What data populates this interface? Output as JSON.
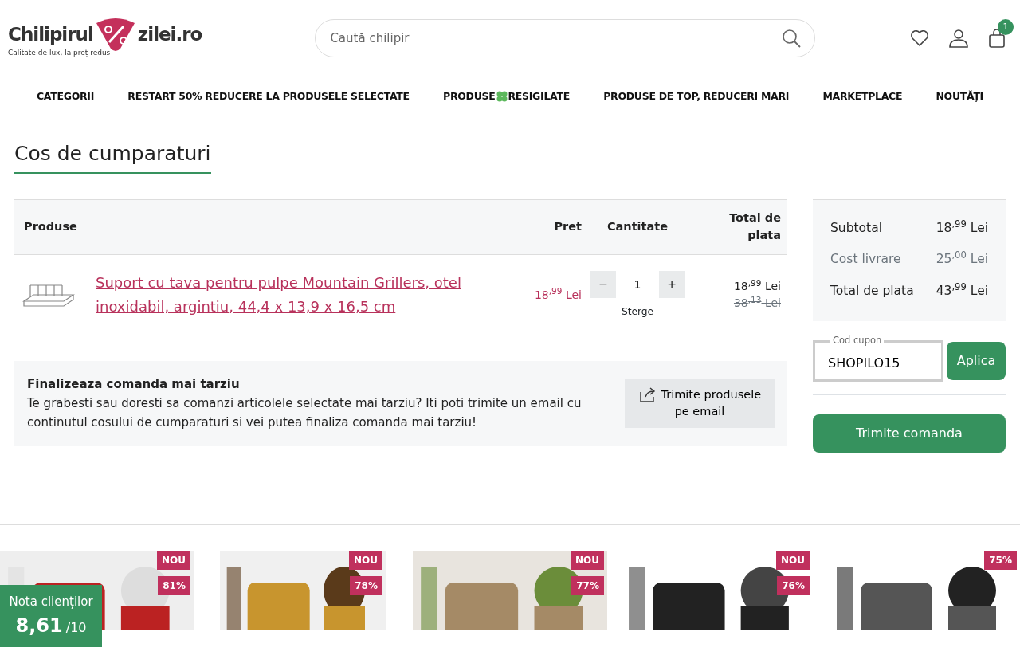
{
  "header": {
    "logo": {
      "left": "Chilipirul",
      "right": "zilei.ro",
      "tagline": "Calitate de lux, la preț redus"
    },
    "search": {
      "placeholder": "Caută chilipir"
    },
    "cart_count": "1"
  },
  "nav": [
    {
      "label": "CATEGORII"
    },
    {
      "label": "RESTART 50% REDUCERE LA PRODUSELE SELECTATE"
    },
    {
      "label": "PRODUSE",
      "label_after": "RESIGILATE",
      "clover": true
    },
    {
      "label": "PRODUSE DE TOP, REDUCERI MARI"
    },
    {
      "label": "MARKETPLACE"
    },
    {
      "label": "NOUTĂȚI"
    }
  ],
  "page_title": "Cos de cumparaturi",
  "table": {
    "columns": [
      "Produse",
      "Pret",
      "Cantitate",
      "Total de plata"
    ],
    "rows": [
      {
        "name": "Suport cu tava pentru pulpe Mountain Grillers, otel inoxidabil, argintiu, 44,4 x 13,9 x 16,5 cm",
        "price": "18$^{,99}$ Lei",
        "quantity": "1",
        "minus": "−",
        "plus": "+",
        "remove": "Sterge",
        "total": "18$^{,99}$ Lei",
        "old_total": "38$^{,13}$ Lei"
      }
    ]
  },
  "later": {
    "title": "Finalizeaza comanda mai tarziu",
    "text": "Te grabesti sau doresti sa comanzi articolele selectate mai tarziu? Iti poti trimite un email cu continutul cosului de cumparaturi si vei putea finaliza comanda mai tarziu!",
    "button": "Trimite produsele pe email"
  },
  "summary": [
    {
      "label": "Subtotal",
      "value": "18$^{,99}$ Lei",
      "muted": false
    },
    {
      "label": "Cost livrare",
      "value": "25$^{,00}$ Lei",
      "muted": true
    },
    {
      "label": "Total de plata",
      "value": "43$^{,99}$ Lei",
      "muted": false
    }
  ],
  "coupon": {
    "label": "Cod cupon",
    "value": "SHOPILO15",
    "button": "Aplica"
  },
  "submit": "Trimite comanda",
  "products": [
    {
      "badges": [
        "NOU",
        "81%"
      ]
    },
    {
      "badges": [
        "NOU",
        "78%"
      ]
    },
    {
      "badges": [
        "NOU",
        "77%"
      ]
    },
    {
      "badges": [
        "NOU",
        "76%"
      ]
    },
    {
      "badges": [
        "75%"
      ]
    }
  ],
  "rating": {
    "label": "Nota clienților",
    "score": "8,61",
    "scale": "/10"
  }
}
